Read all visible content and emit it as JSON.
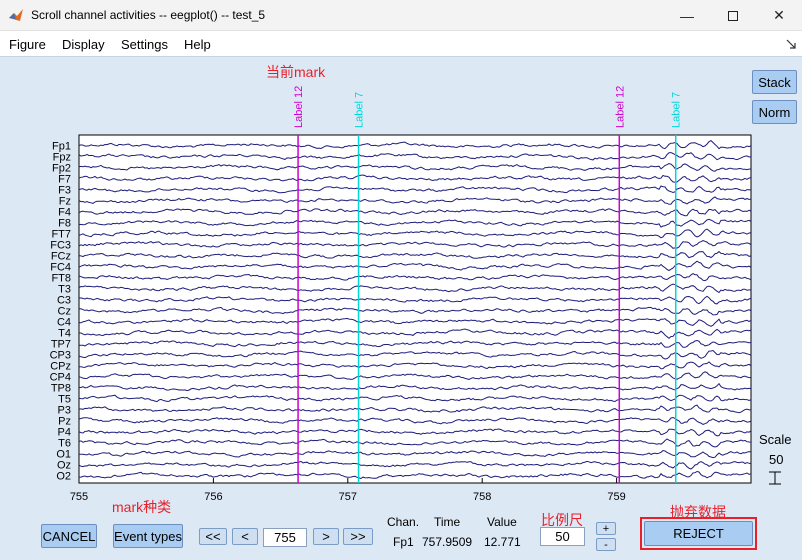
{
  "window": {
    "title": "Scroll channel activities -- eegplot() -- test_5"
  },
  "menu": [
    "Figure",
    "Display",
    "Settings",
    "Help"
  ],
  "side_buttons": {
    "stack": "Stack",
    "norm": "Norm"
  },
  "markers": [
    {
      "label": "Label 12",
      "time": 756.63,
      "color": "#d000d0"
    },
    {
      "label": "Label 7",
      "time": 757.08,
      "color": "#00d8d8"
    },
    {
      "label": "Label 12",
      "time": 759.02,
      "color": "#d000d0"
    },
    {
      "label": "Label 7",
      "time": 759.44,
      "color": "#00d8d8"
    }
  ],
  "channels": [
    "Fp1",
    "Fpz",
    "Fp2",
    "F7",
    "F3",
    "Fz",
    "F4",
    "F8",
    "FT7",
    "FC3",
    "FCz",
    "FC4",
    "FT8",
    "T3",
    "C3",
    "Cz",
    "C4",
    "T4",
    "TP7",
    "CP3",
    "CPz",
    "CP4",
    "TP8",
    "T5",
    "P3",
    "Pz",
    "P4",
    "T6",
    "O1",
    "Oz",
    "O2"
  ],
  "x_axis": {
    "range": [
      755,
      760
    ],
    "ticks": [
      "755",
      "756",
      "757",
      "758",
      "759"
    ]
  },
  "scale": {
    "label": "Scale",
    "value": "50"
  },
  "controls": {
    "cancel": "CANCEL",
    "event_types": "Event types",
    "rewind_fast": "<<",
    "rewind": "<",
    "position": "755",
    "forward": ">",
    "forward_fast": ">>",
    "scale_value": "50",
    "plus": "+",
    "minus": "-",
    "reject": "REJECT"
  },
  "status": {
    "chan_header": "Chan.",
    "time_header": "Time",
    "value_header": "Value",
    "chan": "Fp1",
    "time": "757.9509",
    "value": "12.771"
  },
  "annotations": {
    "current_mark": "当前mark",
    "mark_type": "mark种类",
    "ruler": "比例尺",
    "reject_data": "抛弃数据"
  },
  "colors": {
    "trace": "#1c1c7c",
    "annotation": "#e8202a"
  }
}
